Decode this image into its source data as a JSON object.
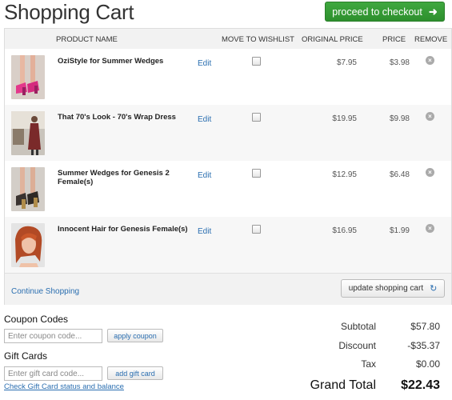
{
  "title": "Shopping Cart",
  "checkout_label": "proceed to checkout",
  "columns": {
    "name": "PRODUCT NAME",
    "wishlist": "MOVE TO WISHLIST",
    "original": "ORIGINAL PRICE",
    "price": "PRICE",
    "remove": "REMOVE"
  },
  "items": [
    {
      "name": "OziStyle for Summer Wedges",
      "edit": "Edit",
      "original": "$7.95",
      "price": "$3.98",
      "thumb": "pink wedge shoes on legs"
    },
    {
      "name": "That 70's Look - 70's Wrap Dress",
      "edit": "Edit",
      "original": "$19.95",
      "price": "$9.98",
      "thumb": "woman in wrap dress in room"
    },
    {
      "name": "Summer Wedges for Genesis 2 Female(s)",
      "edit": "Edit",
      "original": "$12.95",
      "price": "$6.48",
      "thumb": "gold wedge shoes on legs"
    },
    {
      "name": "Innocent Hair for Genesis Female(s)",
      "edit": "Edit",
      "original": "$16.95",
      "price": "$1.99",
      "thumb": "red-haired woman portrait"
    }
  ],
  "continue_label": "Continue Shopping",
  "update_label": "update shopping cart",
  "coupon": {
    "title": "Coupon Codes",
    "placeholder": "Enter coupon code...",
    "button": "apply coupon"
  },
  "giftcard": {
    "title": "Gift Cards",
    "placeholder": "Enter gift card code...",
    "button": "add gift card",
    "link": "Check Gift Card status and balance"
  },
  "totals": {
    "subtotal_label": "Subtotal",
    "subtotal": "$57.80",
    "discount_label": "Discount",
    "discount": "-$35.37",
    "tax_label": "Tax",
    "tax": "$0.00",
    "grand_label": "Grand Total",
    "grand": "$22.43"
  },
  "colors": {
    "accent": "#2d8f2d",
    "link": "#2a6eb0"
  }
}
